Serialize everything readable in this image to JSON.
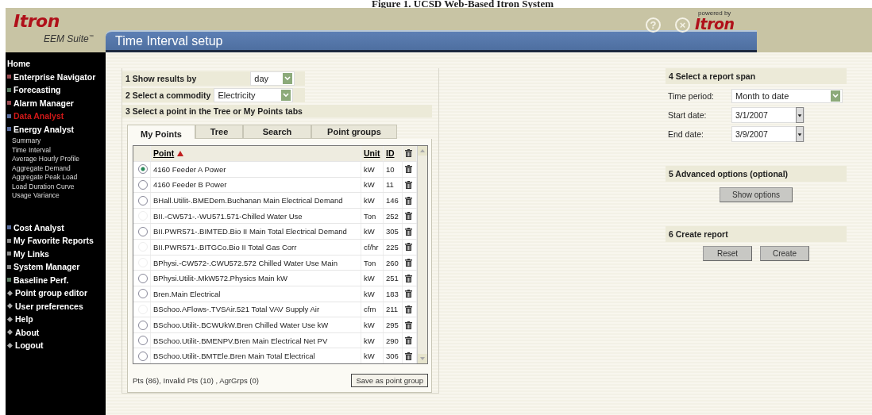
{
  "caption": "Figure 1. UCSD Web-Based Itron System",
  "logo": {
    "brand": "Itron",
    "product": "EEM Suite",
    "tm": "™"
  },
  "title": "Time Interval setup",
  "header_icons": [
    {
      "glyph": "?"
    },
    {
      "glyph": "×"
    }
  ],
  "powered": {
    "label": "powered by",
    "brand": "Itron"
  },
  "sidebar": {
    "items": [
      {
        "label": "Home",
        "kind": "plain",
        "selected": false
      },
      {
        "label": "Enterprise Navigator",
        "kind": "section",
        "color": "#9a4a52",
        "selected": false
      },
      {
        "label": "Forecasting",
        "kind": "section",
        "color": "#5a7a62",
        "selected": false
      },
      {
        "label": "Alarm Manager",
        "kind": "section",
        "color": "#9a4a52",
        "selected": false
      },
      {
        "label": "Data Analyst",
        "kind": "section",
        "color": "#5a6e9e",
        "selected": true
      },
      {
        "label": "Energy Analyst",
        "kind": "section",
        "color": "#5a6e9e",
        "selected": false,
        "children": [
          {
            "label": "Summary"
          },
          {
            "label": "Time Interval"
          },
          {
            "label": "Average Hourly Profile"
          },
          {
            "label": "Aggregate Demand"
          },
          {
            "label": "Aggregate Peak Load"
          },
          {
            "label": "Load Duration Curve"
          },
          {
            "label": "Usage Variance"
          }
        ]
      },
      {
        "label": "Cost Analyst",
        "kind": "section",
        "color": "#5a6e9e",
        "selected": false
      },
      {
        "label": "My Favorite Reports",
        "kind": "section",
        "color": "#8a8a8a",
        "selected": false
      },
      {
        "label": "My Links",
        "kind": "section",
        "color": "#8a8a8a",
        "selected": false
      },
      {
        "label": "System Manager",
        "kind": "section",
        "color": "#8a8a8a",
        "selected": false
      },
      {
        "label": "Baseline Perf.",
        "kind": "section",
        "color": "#5a7a62",
        "selected": false
      },
      {
        "label": "Point group editor",
        "kind": "tool",
        "selected": false
      },
      {
        "label": "User preferences",
        "kind": "tool",
        "selected": false
      },
      {
        "label": "Help",
        "kind": "tool",
        "selected": false
      },
      {
        "label": "About",
        "kind": "tool",
        "selected": false
      },
      {
        "label": "Logout",
        "kind": "tool",
        "selected": false
      }
    ]
  },
  "step1": {
    "label": "1 Show results by",
    "value": "day"
  },
  "step2": {
    "label": "2 Select a commodity",
    "value": "Electricity"
  },
  "step3": {
    "label": "3  Select a point in the Tree or My Points tabs"
  },
  "tabs": [
    {
      "label": "My Points",
      "selected": true
    },
    {
      "label": "Tree",
      "selected": false
    },
    {
      "label": "Search",
      "selected": false
    },
    {
      "label": "Point groups",
      "selected": false
    }
  ],
  "table": {
    "columns": [
      {
        "label": "Point",
        "sorted": true
      },
      {
        "label": "Unit"
      },
      {
        "label": "ID"
      }
    ],
    "rows": [
      {
        "point": "4160 Feeder A Power",
        "unit": "kW",
        "id": "10",
        "selected": true,
        "disabled": false
      },
      {
        "point": "4160 Feeder B Power",
        "unit": "kW",
        "id": "11",
        "selected": false,
        "disabled": false
      },
      {
        "point": "BHall.Utilit-.BMEDem.Buchanan Main Electrical Demand",
        "unit": "kW",
        "id": "146",
        "selected": false,
        "disabled": false
      },
      {
        "point": "BII.-CW571-.-WU571.571-Chilled Water Use",
        "unit": "Ton",
        "id": "252",
        "selected": false,
        "disabled": true
      },
      {
        "point": "BII.PWR571-.BIMTED.Bio II Main Total Electrical Demand",
        "unit": "kW",
        "id": "305",
        "selected": false,
        "disabled": false
      },
      {
        "point": "BII.PWR571-.BITGCo.Bio II Total Gas Corr",
        "unit": "cf/hr",
        "id": "225",
        "selected": false,
        "disabled": true
      },
      {
        "point": "BPhysi.-CW572-.CWU572.572 Chilled Water Use Main",
        "unit": "Ton",
        "id": "260",
        "selected": false,
        "disabled": true
      },
      {
        "point": "BPhysi.Utilit-.MkW572.Physics Main kW",
        "unit": "kW",
        "id": "251",
        "selected": false,
        "disabled": false
      },
      {
        "point": "Bren.Main Electrical",
        "unit": "kW",
        "id": "183",
        "selected": false,
        "disabled": false
      },
      {
        "point": "BSchoo.AFlows-.TVSAir.521 Total VAV Supply Air",
        "unit": "cfm",
        "id": "211",
        "selected": false,
        "disabled": true
      },
      {
        "point": "BSchoo.Utilit-.BCWUkW.Bren Chilled Water Use kW",
        "unit": "kW",
        "id": "295",
        "selected": false,
        "disabled": false
      },
      {
        "point": "BSchoo.Utilit-.BMENPV.Bren Main Electrical Net PV",
        "unit": "kW",
        "id": "290",
        "selected": false,
        "disabled": false
      },
      {
        "point": "BSchoo.Utilit-.BMTEle.Bren Main Total Electrical",
        "unit": "kW",
        "id": "306",
        "selected": false,
        "disabled": false
      }
    ]
  },
  "summary": "Pts (86),  Invalid Pts (10) , AgrGrps (0)",
  "save_button": "Save as point group",
  "step4": {
    "label": "4 Select a report span",
    "fields": [
      {
        "label": "Time period:",
        "value": "Month to date",
        "kind": "select"
      },
      {
        "label": "Start date:",
        "value": "3/1/2007",
        "kind": "date"
      },
      {
        "label": "End date:",
        "value": "3/9/2007",
        "kind": "date"
      }
    ]
  },
  "step5": {
    "label": "5 Advanced options (optional)",
    "button": "Show options"
  },
  "step6": {
    "label": "6 Create report",
    "buttons": [
      "Reset",
      "Create"
    ]
  }
}
